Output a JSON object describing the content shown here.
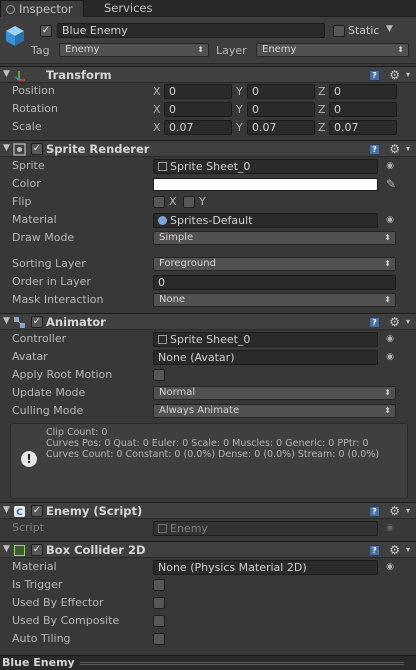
{
  "tabs": {
    "inspector": "Inspector",
    "services": "Services"
  },
  "object": {
    "name": "Blue Enemy",
    "active": true,
    "static_label": "Static",
    "tag_label": "Tag",
    "tag_value": "Enemy",
    "layer_label": "Layer",
    "layer_value": "Enemy"
  },
  "transform": {
    "title": "Transform",
    "position_label": "Position",
    "rotation_label": "Rotation",
    "scale_label": "Scale",
    "axis_x": "X",
    "axis_y": "Y",
    "axis_z": "Z",
    "position": {
      "x": "0",
      "y": "0",
      "z": "0"
    },
    "rotation": {
      "x": "0",
      "y": "0",
      "z": "0"
    },
    "scale": {
      "x": "0.07",
      "y": "0.07",
      "z": "0.07"
    }
  },
  "sprite_renderer": {
    "title": "Sprite Renderer",
    "sprite_label": "Sprite",
    "sprite_value": "Sprite Sheet_0",
    "color_label": "Color",
    "color_value": "#ffffff",
    "flip_label": "Flip",
    "flip_x": "X",
    "flip_y": "Y",
    "material_label": "Material",
    "material_value": "Sprites-Default",
    "draw_mode_label": "Draw Mode",
    "draw_mode_value": "Simple",
    "sorting_layer_label": "Sorting Layer",
    "sorting_layer_value": "Foreground",
    "order_label": "Order in Layer",
    "order_value": "0",
    "mask_label": "Mask Interaction",
    "mask_value": "None"
  },
  "animator": {
    "title": "Animator",
    "controller_label": "Controller",
    "controller_value": "Sprite Sheet_0",
    "avatar_label": "Avatar",
    "avatar_value": "None (Avatar)",
    "root_motion_label": "Apply Root Motion",
    "update_mode_label": "Update Mode",
    "update_mode_value": "Normal",
    "culling_label": "Culling Mode",
    "culling_value": "Always Animate",
    "info_line1": "Clip Count: 0",
    "info_line2": "Curves Pos: 0 Quat: 0 Euler: 0 Scale: 0 Muscles: 0 Generic: 0 PPtr: 0",
    "info_line3": "Curves Count: 0 Constant: 0 (0.0%) Dense: 0 (0.0%) Stream: 0 (0.0%)"
  },
  "enemy_script": {
    "title": "Enemy (Script)",
    "script_label": "Script",
    "script_value": "Enemy"
  },
  "box_collider": {
    "title": "Box Collider 2D",
    "material_label": "Material",
    "material_value": "None (Physics Material 2D)",
    "trigger_label": "Is Trigger",
    "effector_label": "Used By Effector",
    "composite_label": "Used By Composite",
    "tiling_label": "Auto Tiling"
  },
  "footer": {
    "title": "Blue Enemy"
  },
  "colors": {
    "panel": "#383838",
    "header": "#404040",
    "field": "#2a2a2a",
    "accent": "#4a6ea0"
  }
}
